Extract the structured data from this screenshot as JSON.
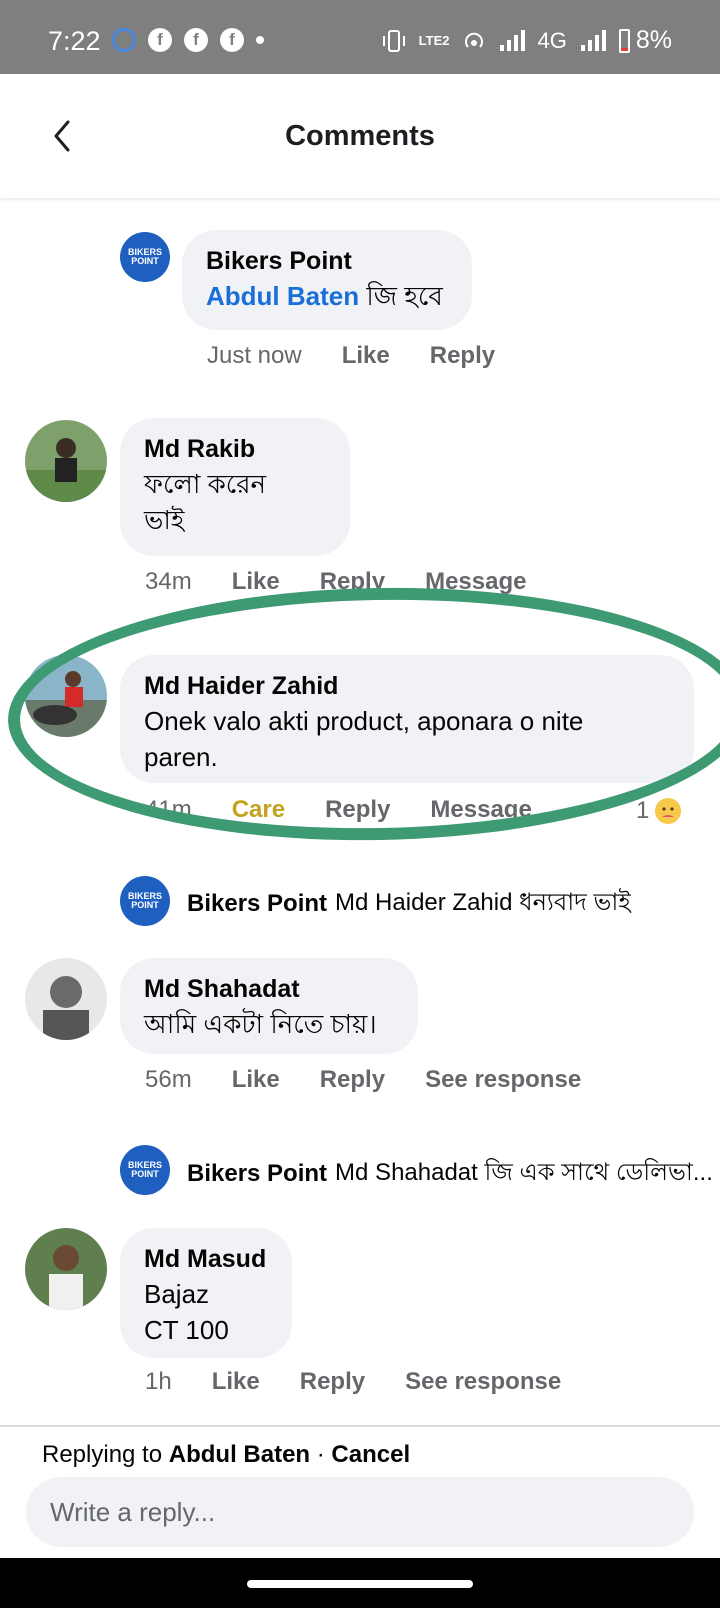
{
  "status_bar": {
    "time": "7:22",
    "network": "4G",
    "lte_label": "LTE2",
    "battery": "8%"
  },
  "header": {
    "title": "Comments"
  },
  "comments": [
    {
      "author": "Bikers Point",
      "mention": "Abdul Baten",
      "text": "জি হবে",
      "time": "Just now",
      "like": "Like",
      "reply": "Reply",
      "avatar_text": "BIKERS POINT"
    },
    {
      "author": "Md Rakib",
      "text_line1": "ফলো করেন",
      "text_line2": "ভাই",
      "time": "34m",
      "like": "Like",
      "reply": "Reply",
      "message": "Message"
    },
    {
      "author": "Md Haider Zahid",
      "text_line1": "Onek valo akti product, aponara o nite",
      "text_line2": "paren.",
      "time": "41m",
      "reaction": "Care",
      "reply": "Reply",
      "message": "Message",
      "reaction_count": "1"
    },
    {
      "author": "Bikers Point",
      "text": "Md Haider Zahid ধন্যবাদ ভাই",
      "avatar_text": "BIKERS POINT"
    },
    {
      "author": "Md Shahadat",
      "text": "আমি একটা নিতে চায়।",
      "time": "56m",
      "like": "Like",
      "reply": "Reply",
      "see_response": "See response"
    },
    {
      "author": "Bikers Point",
      "text": "Md Shahadat জি এক সাথে ডেলিভা...",
      "avatar_text": "BIKERS POINT"
    },
    {
      "author": "Md Masud",
      "text_line1": "Bajaz",
      "text_line2": "CT 100",
      "time": "1h",
      "like": "Like",
      "reply": "Reply",
      "see_response": "See response"
    }
  ],
  "reply_bar": {
    "replying_prefix": "Replying to",
    "replying_name": "Abdul Baten",
    "separator": "·",
    "cancel": "Cancel",
    "placeholder": "Write a reply..."
  },
  "colors": {
    "status_bar": "#7f7f7f",
    "mention": "#1a6ed8",
    "care_reaction": "#c3a21c",
    "highlight_oval": "#3e9a72",
    "bikers_point_logo": "#1f5fbf"
  }
}
